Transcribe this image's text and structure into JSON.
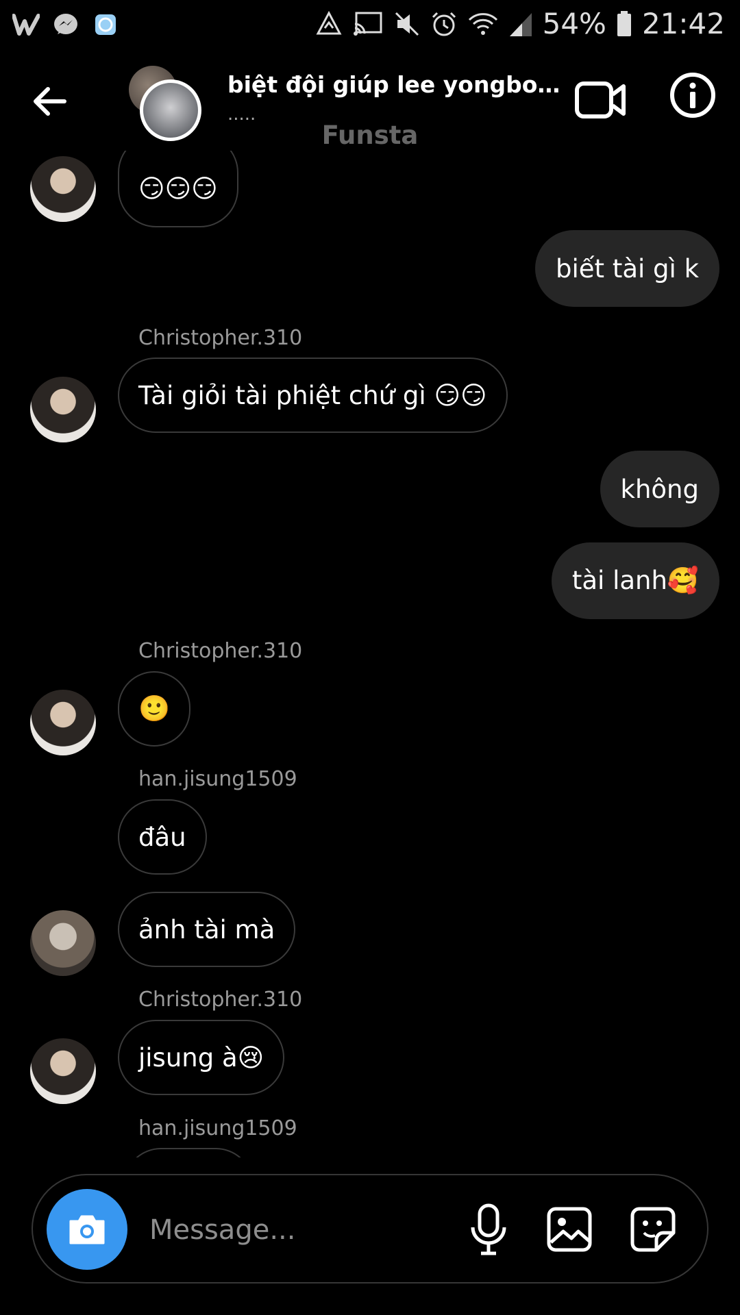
{
  "status_bar": {
    "battery": "54%",
    "time": "21:42"
  },
  "header": {
    "title": "biệt đội giúp lee yongbok kết …",
    "subtitle": ".....",
    "banner": "Funsta"
  },
  "messages": {
    "m1": {
      "text": "😏😏😏"
    },
    "m2": {
      "text": "biết tài gì k"
    },
    "m3": {
      "sender": "Christopher.310",
      "text": "Tài giỏi tài phiệt chứ gì 😏😏"
    },
    "m4": {
      "text": "không"
    },
    "m5": {
      "text": "tài lanh🥰"
    },
    "m6": {
      "sender": "Christopher.310",
      "text": "🙂"
    },
    "m7": {
      "sender": "han.jisung1509",
      "text": "đâu"
    },
    "m8": {
      "text": "ảnh tài mà"
    },
    "m9": {
      "sender": "Christopher.310",
      "text": "jisung à😢"
    },
    "m10": {
      "sender": "han.jisung1509"
    }
  },
  "composer": {
    "placeholder": "Message..."
  },
  "colors": {
    "background": "#000000",
    "outgoing_bubble": "#262626",
    "incoming_border": "#3a3a3a",
    "camera_button": "#3897f0"
  }
}
